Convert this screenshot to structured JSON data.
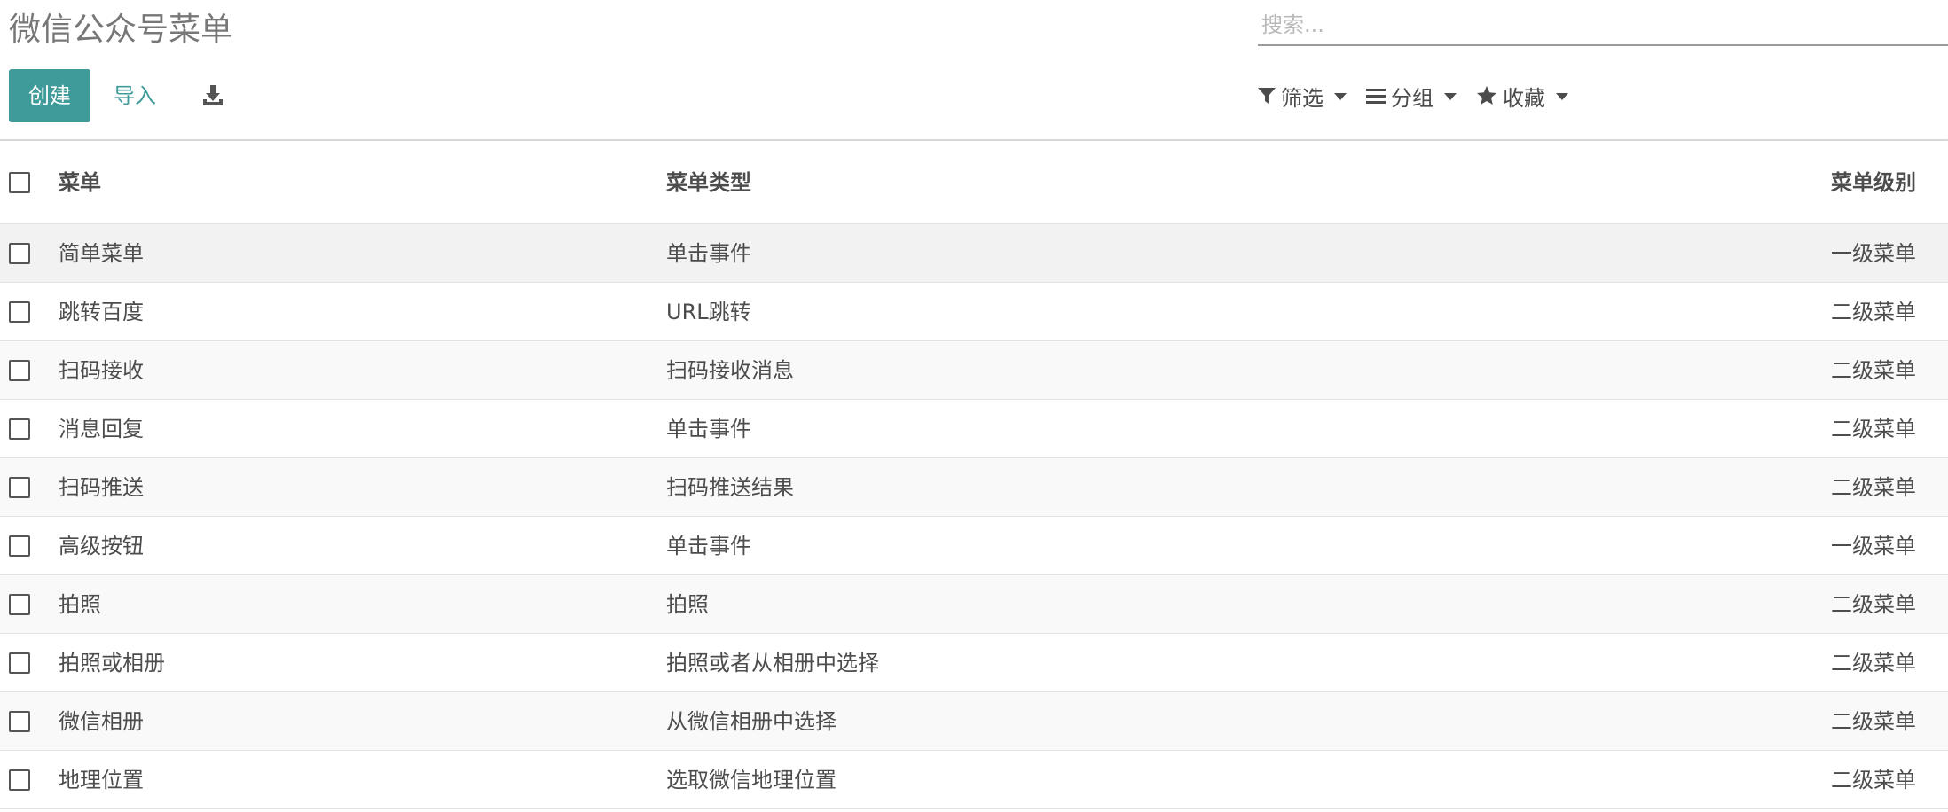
{
  "title": "微信公众号菜单",
  "search": {
    "placeholder": "搜索..."
  },
  "buttons": {
    "create": "创建",
    "import": "导入"
  },
  "search_options": {
    "filter": "筛选",
    "group": "分组",
    "favorite": "收藏"
  },
  "table": {
    "columns": {
      "name": "菜单",
      "type": "菜单类型",
      "level": "菜单级别"
    },
    "rows": [
      {
        "name": "简单菜单",
        "type": "单击事件",
        "level": "一级菜单"
      },
      {
        "name": "跳转百度",
        "type": "URL跳转",
        "level": "二级菜单"
      },
      {
        "name": "扫码接收",
        "type": "扫码接收消息",
        "level": "二级菜单"
      },
      {
        "name": "消息回复",
        "type": "单击事件",
        "level": "二级菜单"
      },
      {
        "name": "扫码推送",
        "type": "扫码推送结果",
        "level": "二级菜单"
      },
      {
        "name": "高级按钮",
        "type": "单击事件",
        "level": "一级菜单"
      },
      {
        "name": "拍照",
        "type": "拍照",
        "level": "二级菜单"
      },
      {
        "name": "拍照或相册",
        "type": "拍照或者从相册中选择",
        "level": "二级菜单"
      },
      {
        "name": "微信相册",
        "type": "从微信相册中选择",
        "level": "二级菜单"
      },
      {
        "name": "地理位置",
        "type": "选取微信地理位置",
        "level": "二级菜单"
      }
    ]
  },
  "colors": {
    "primary": "#3f9b9a",
    "text": "#4c4c4c",
    "title": "#777777"
  }
}
